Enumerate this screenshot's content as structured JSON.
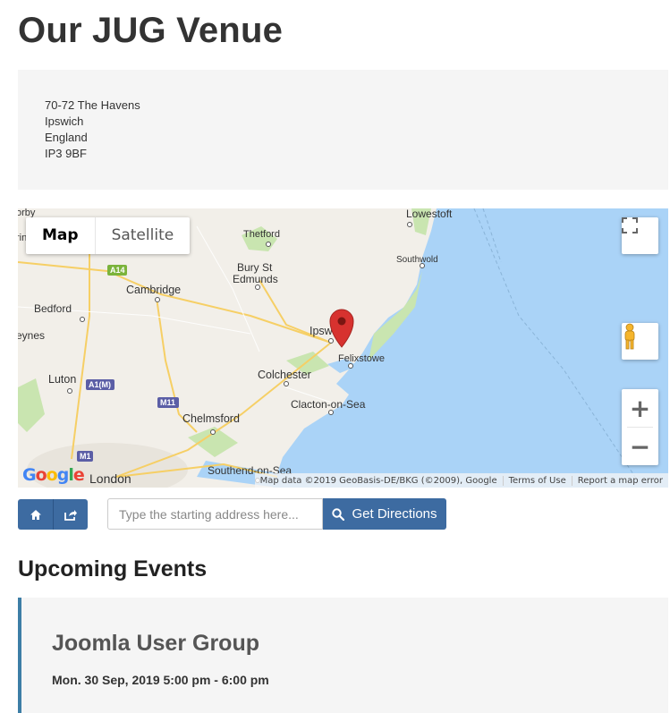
{
  "page": {
    "title": "Our JUG Venue"
  },
  "address": {
    "lines": [
      "70-72 The Havens",
      "Ipswich",
      "England",
      "IP3 9BF"
    ]
  },
  "map": {
    "type_buttons": {
      "map": "Map",
      "satellite": "Satellite"
    },
    "place_labels": {
      "lowestoft": "Lowestoft",
      "thetford": "Thetford",
      "southwold": "Southwold",
      "bury1": "Bury St",
      "bury2": "Edmunds",
      "cambridge": "Cambridge",
      "bedford": "Bedford",
      "ipswich": "Ipswich",
      "felixstowe": "Felixstowe",
      "colchester": "Colchester",
      "luton": "Luton",
      "clacton": "Clacton-on-Sea",
      "chelmsford": "Chelmsford",
      "london": "London",
      "southend": "Southend-on-Sea",
      "orby": "orby",
      "ring": "ring",
      "eynes": "eynes"
    },
    "road_shields": {
      "a14": "A14",
      "a1m": "A1(M)",
      "m11": "M11",
      "m1": "M1"
    },
    "attribution": {
      "data": "Map data ©2019 GeoBasis-DE/BKG (©2009), Google",
      "terms": "Terms of Use",
      "report": "Report a map error"
    },
    "logo": "Google",
    "colors": {
      "water": "#aad3f7",
      "land": "#f2efe9",
      "green": "#c9e5b0",
      "marker": "#d7322f"
    }
  },
  "directions": {
    "placeholder": "Type the starting address here...",
    "button_label": "Get Directions",
    "button_color": "#3d6ba1"
  },
  "events": {
    "heading": "Upcoming Events",
    "items": [
      {
        "title": "Joomla User Group",
        "date": "Mon. 30 Sep, 2019 5:00 pm - 6:00 pm"
      }
    ]
  }
}
